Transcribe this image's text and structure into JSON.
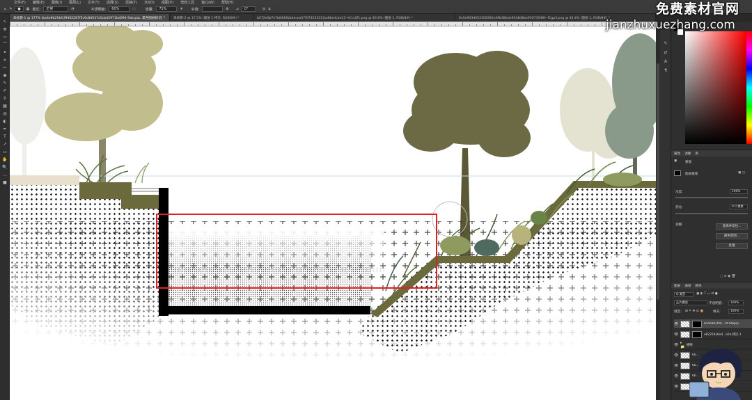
{
  "app": {
    "menu": [
      "文件(F)",
      "编辑(E)",
      "图像(I)",
      "图层(L)",
      "文字(Y)",
      "选择(S)",
      "滤镜(T)",
      "3D(D)",
      "视图(V)",
      "增效工具",
      "窗口(W)",
      "帮助(H)"
    ]
  },
  "options": {
    "mode_label": "模式:",
    "mode_value": "正常",
    "opacity_label": "不透明度:",
    "opacity_value": "60%",
    "flow_label": "流量:",
    "flow_value": "71%",
    "smooth_label": "平滑:",
    "angle_value": "0°"
  },
  "tabs": [
    {
      "label": "未标题-1 @ 177% (ba4e8b2fdd1f9462287f5c9c8d547a5cb42971bd094-9sbypip, 黑色图层标记) *",
      "active": true
    },
    {
      "label": "未标题-2 @ 17.5% (图层 1 拷贝, RGB/8#) *",
      "active": false
    },
    {
      "label": "b072e5b7e7b8449bb4ecea57f073225212adfbedcbe13~fc1c0f1.png @ 40.6% (图层 1, RGB/8#) *",
      "active": false
    },
    {
      "label": "6e5e903d053302962e49b48bde9548d8be9507304f8~f1gp3.png @ 44.4% (图层 1, RGB/8#) *",
      "active": false
    }
  ],
  "tools": [
    "↖",
    "✥",
    "▭",
    "⌒",
    "✦",
    "⌗",
    "✂",
    "◉",
    "✎",
    "✐",
    "⚲",
    "▦",
    "◍",
    "◐",
    "✒",
    "T",
    "↗",
    "▭",
    "✋",
    "🔍",
    "…",
    "■"
  ],
  "side_icons": [
    "✎",
    "⇄",
    "A",
    "¶"
  ],
  "colors": {
    "accent_red": "#e02020",
    "soil": "#6b6a3c",
    "tree_dark": "#6b6a45",
    "tree_light": "#c2bd8c"
  },
  "properties_panel": {
    "tabs": [
      "属性",
      "调整",
      "库"
    ],
    "layer_kind": "蒙版",
    "pixel_mask": "图层蒙版",
    "density_label": "浓度:",
    "density_value": "100%",
    "feather_label": "羽化:",
    "feather_value": "0.0 像素",
    "adjust_label": "调整:",
    "btn_select_mask": "选择并遮住...",
    "btn_color_range": "颜色范围...",
    "btn_invert": "反相"
  },
  "layers_panel": {
    "tabs": [
      "图层",
      "通道",
      "路径"
    ],
    "kind_label": "Q 类型",
    "blend_mode": "正片叠底",
    "opacity_label": "不透明度:",
    "opacity_value": "100%",
    "lock_label": "锁定:",
    "fill_label": "填充:",
    "fill_value": "100%",
    "layers": [
      {
        "name": "ba4e8b2f66...9f-9sbpip",
        "selected": true,
        "mask": true
      },
      {
        "name": "e8225b36e4...a5b 拷贝 3",
        "selected": false,
        "mask": true
      },
      {
        "name": "植物",
        "selected": false,
        "mask": false,
        "group": true
      },
      {
        "name": "6b...",
        "selected": false,
        "mask": false
      },
      {
        "name": "6b...",
        "selected": false,
        "mask": false
      },
      {
        "name": "6b...",
        "selected": false,
        "mask": false
      },
      {
        "name": "6b...",
        "selected": false,
        "mask": false
      }
    ]
  },
  "watermark": {
    "line1": "免费素材官网",
    "line2": "jianzhuxuezhang.com"
  }
}
